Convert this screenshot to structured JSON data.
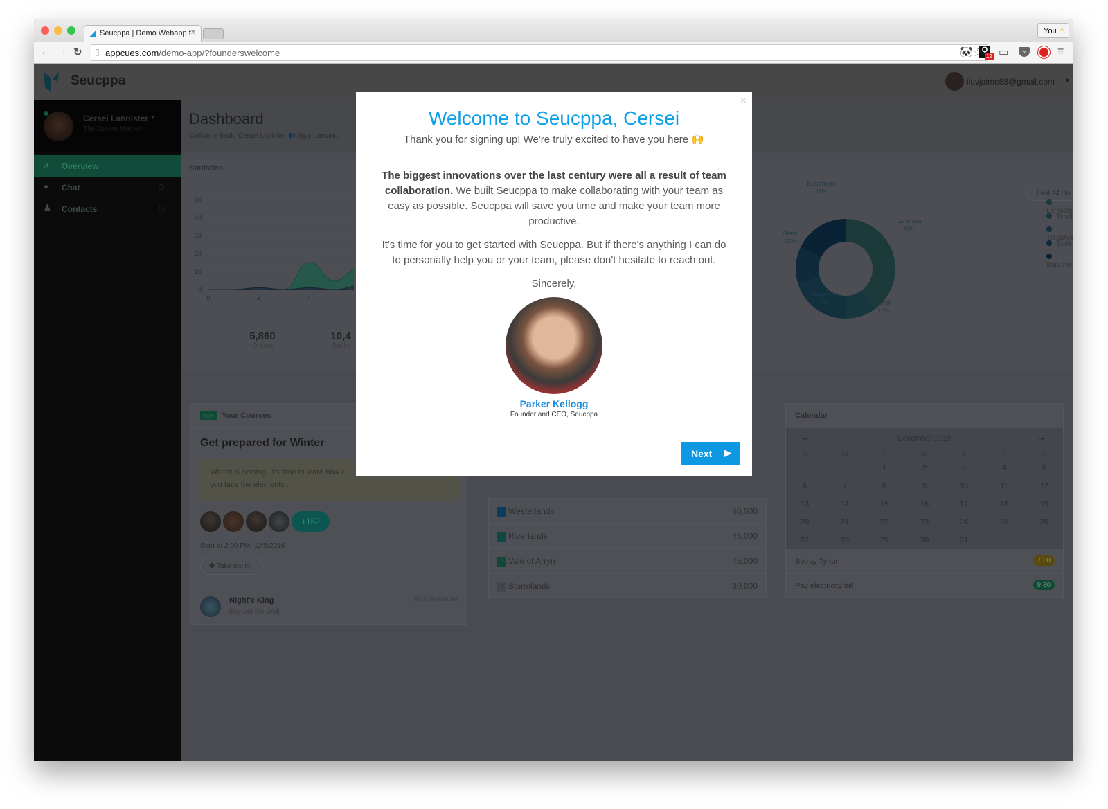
{
  "browser": {
    "tab_title": "Seucppa | Demo Webapp f",
    "url_domain": "appcues.com",
    "url_path": "/demo-app/?founderswelcome",
    "profile_label": "You",
    "extension_badge": "12"
  },
  "app": {
    "brand": "Seucppa",
    "user_email": "iluvjaime88@gmail.com"
  },
  "sidebar": {
    "user_name": "Cersei Lannister",
    "user_title": "The Queen Mother",
    "items": [
      {
        "label": "Overview"
      },
      {
        "label": "Chat"
      },
      {
        "label": "Contacts"
      }
    ]
  },
  "dashboard": {
    "title": "Dashboard",
    "subtitle": "Welcome back, Cersei Lanister,",
    "location": "King's Landing,",
    "statistics_label": "Statistics",
    "range_button": "Last 24 Hours",
    "stats": [
      {
        "value": "5,860",
        "label": "Orders"
      },
      {
        "value": "10,4",
        "label": "Sellin"
      }
    ]
  },
  "chart_data": [
    {
      "type": "area",
      "x_ticks": [
        "0",
        "2",
        "4"
      ],
      "y_ticks": [
        "0",
        "10",
        "20",
        "30",
        "40",
        "50",
        "60"
      ],
      "ylim": [
        0,
        60
      ],
      "grid": true,
      "series": [
        {
          "color": "#1e5c48",
          "x": [
            0,
            1,
            2,
            3,
            4,
            5,
            6
          ],
          "values": [
            0,
            0,
            1,
            0,
            15,
            5,
            12
          ]
        },
        {
          "color": "#243347",
          "x": [
            0,
            1,
            2,
            3,
            4,
            5,
            6
          ],
          "values": [
            0,
            0,
            1,
            0,
            1,
            0,
            2
          ]
        }
      ]
    },
    {
      "type": "pie",
      "donut": true,
      "legend": "right",
      "categories": [
        "Lannister",
        "Tyrell",
        "Targaryen",
        "Stark",
        "Baratheon"
      ],
      "values": [
        40,
        10,
        20,
        12,
        18
      ],
      "labels": [
        "40%",
        "10%",
        "20%",
        "12%",
        "18%"
      ],
      "colors": [
        "#1d3a3b",
        "#18363f",
        "#12303d",
        "#0f2a3c",
        "#0a2236"
      ]
    }
  ],
  "courses": {
    "badge": "New",
    "header": "Your Courses",
    "title": "Get prepared for Winter",
    "description": "Winter is coming, it's time to learn how t\nyou face the elements...",
    "extra_count": "+152",
    "start": "Start at 2:00 PM, 12/5/2016",
    "cta": "Take me in",
    "instructor_name": "Night's King",
    "instructor_location": "Beyond the Wall",
    "instructor_label": "Your Instructor"
  },
  "regions": [
    {
      "rank": "1",
      "name": "Westerlands",
      "value": "50,000",
      "color": "#0d3d5c"
    },
    {
      "rank": "2",
      "name": "Riverlands",
      "value": "45,000",
      "color": "#0d4a45"
    },
    {
      "rank": "3",
      "name": "Vale of Arryn",
      "value": "45,000",
      "color": "#0f4a35"
    },
    {
      "rank": "4",
      "name": "Stormlands",
      "value": "30,000",
      "color": "#45464b"
    }
  ],
  "calendar": {
    "header": "Calendar",
    "month": "December 2015",
    "weekdays": [
      "S",
      "M",
      "T",
      "W",
      "T",
      "F",
      "S"
    ],
    "weeks": [
      [
        "",
        "",
        "1",
        "2",
        "3",
        "4",
        "5"
      ],
      [
        "6",
        "7",
        "8",
        "9",
        "10",
        "11",
        "12"
      ],
      [
        "13",
        "14",
        "15",
        "16",
        "17",
        "18",
        "19"
      ],
      [
        "20",
        "21",
        "22",
        "23",
        "24",
        "25",
        "26"
      ],
      [
        "27",
        "28",
        "29",
        "30",
        "31",
        "",
        ""
      ]
    ],
    "events": [
      {
        "title": "Betray Tyrion",
        "time": "7:30",
        "color": "#5a4a12"
      },
      {
        "title": "Pay electricity bill",
        "time": "9:30",
        "color": "#0f4a3a"
      }
    ]
  },
  "modal": {
    "title": "Welcome to Seucppa, Cersei",
    "subtitle": "Thank you for signing up! We're truly excited to have you here 🙌",
    "para1_bold": "The biggest innovations over the last century were all a result of team collaboration.",
    "para1_rest": " We built Seucppa to make collaborating with your team as easy as possible. Seucppa will save you time and make your team more productive.",
    "para2": "It's time for you to get started with Seucppa. But if there's anything I can do to personally help you or your team, please don't hesitate to reach out.",
    "closing": "Sincerely,",
    "signer_name": "Parker Kellogg",
    "signer_role": "Founder and CEO, Seucppa",
    "next_label": "Next",
    "close_glyph": "×",
    "accent": "#0ea0e6"
  }
}
